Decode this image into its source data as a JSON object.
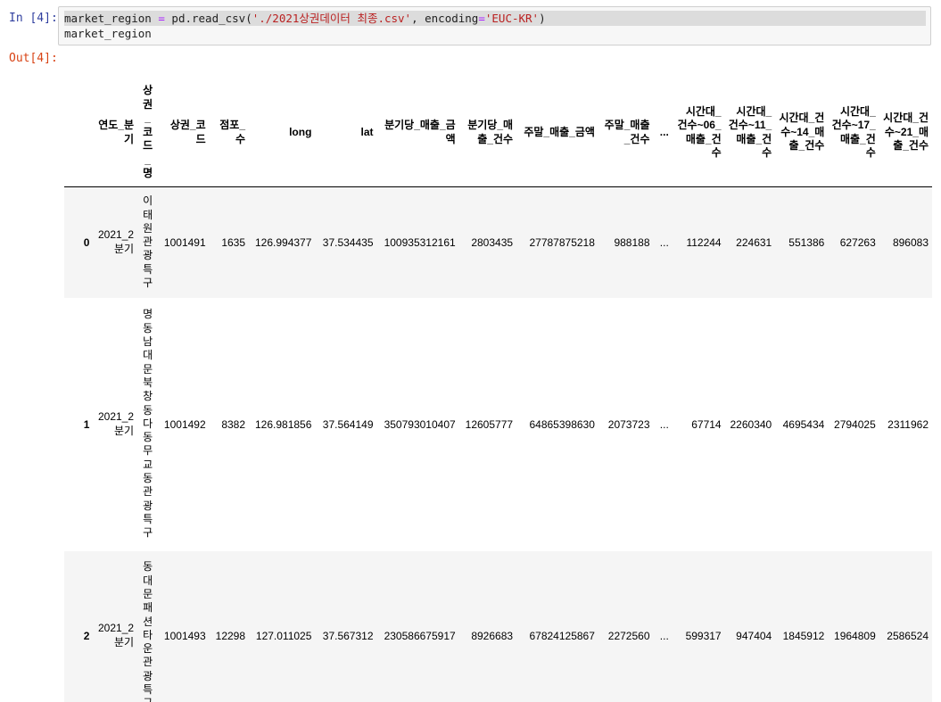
{
  "cell": {
    "in_prompt": "In [4]:",
    "out_prompt": "Out[4]:",
    "code": {
      "line1": {
        "var": "market_region ",
        "op": "=",
        "call": " pd.read_csv(",
        "path": "'./2021상권데이터 최종.csv'",
        "kw": ", encoding",
        "eq": "=",
        "enc": "'EUC-KR'",
        "close": ")"
      },
      "line2": "market_region"
    }
  },
  "table": {
    "columns": [
      "",
      "연도_분기",
      "상권_코드_명",
      "상권_코드",
      "점포_수",
      "long",
      "lat",
      "분기당_매출_금액",
      "분기당_매출_건수",
      "주말_매출_금액",
      "주말_매출_건수",
      "...",
      "시간대_건수~06_매출_건수",
      "시간대_건수~11_매출_건수",
      "시간대_건수~14_매출_건수",
      "시간대_건수~17_매출_건수",
      "시간대_건수~21_매출_건수"
    ],
    "rows": [
      [
        "0",
        "2021_2분기",
        "이태원관광특구",
        "1001491",
        "1635",
        "126.994377",
        "37.534435",
        "100935312161",
        "2803435",
        "27787875218",
        "988188",
        "...",
        "112244",
        "224631",
        "551386",
        "627263",
        "896083"
      ],
      [
        "1",
        "2021_2분기",
        "명동남대문북창동다동무교동관광특구",
        "1001492",
        "8382",
        "126.981856",
        "37.564149",
        "350793010407",
        "12605777",
        "64865398630",
        "2073723",
        "...",
        "67714",
        "2260340",
        "4695434",
        "2794025",
        "2311962"
      ],
      [
        "2",
        "2021_2분기",
        "동대문패션타운관광특구",
        "1001493",
        "12298",
        "127.011025",
        "37.567312",
        "230586675917",
        "8926683",
        "67824125867",
        "2272560",
        "...",
        "599317",
        "947404",
        "1845912",
        "1964809",
        "2586524"
      ]
    ]
  }
}
